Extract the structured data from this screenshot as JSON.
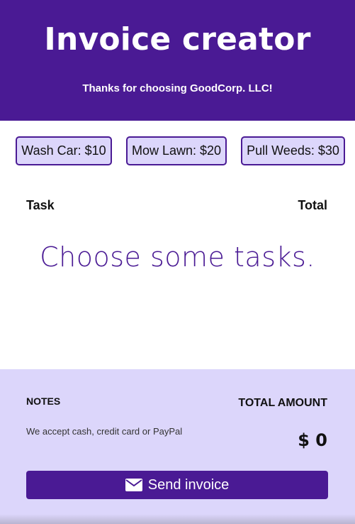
{
  "header": {
    "title": "Invoice creator",
    "subtitle": "Thanks for choosing GoodCorp. LLC!"
  },
  "tasks": [
    {
      "label": "Wash Car: $10"
    },
    {
      "label": "Mow Lawn: $20"
    },
    {
      "label": "Pull Weeds: $30"
    }
  ],
  "table": {
    "task_header": "Task",
    "total_header": "Total",
    "empty_message": "Choose some tasks."
  },
  "footer": {
    "notes_label": "NOTES",
    "notes_text": "We accept cash, credit card or PayPal",
    "total_label": "TOTAL AMOUNT",
    "total_value": "$ 0",
    "send_label": "Send invoice",
    "send_icon": "mail-icon"
  },
  "colors": {
    "primary": "#4a1a94",
    "light": "#dcd6fb"
  }
}
